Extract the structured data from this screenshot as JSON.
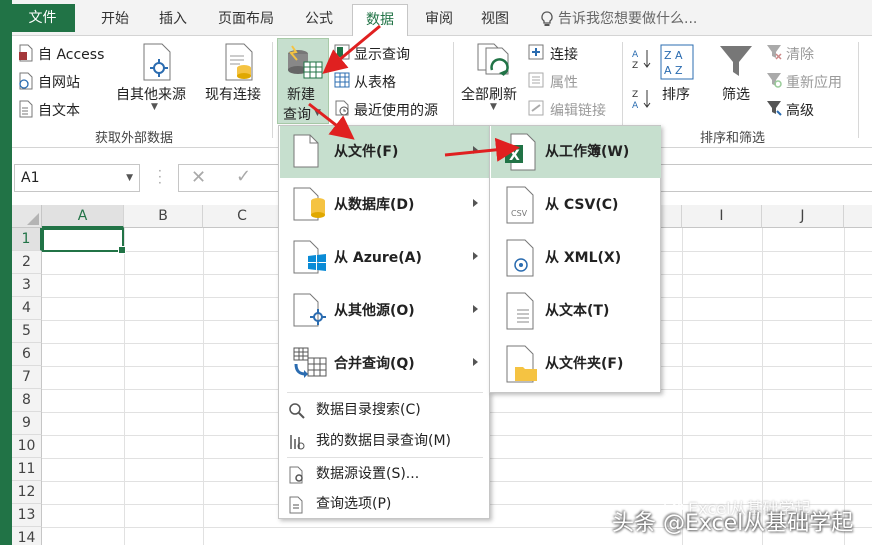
{
  "tabs": {
    "file": "文件",
    "home": "开始",
    "insert": "插入",
    "layout": "页面布局",
    "formulas": "公式",
    "data": "数据",
    "review": "审阅",
    "view": "视图",
    "tell_me": "告诉我您想要做什么..."
  },
  "ribbon": {
    "get_external": {
      "from_access": "自 Access",
      "from_web": "自网站",
      "from_text": "自文本",
      "from_other_l1": "自其他来源",
      "existing_conn": "现有连接",
      "group_label": "获取外部数据"
    },
    "get_transform": {
      "new_query_l1": "新建",
      "new_query_l2": "查询",
      "show_queries": "显示查询",
      "from_table": "从表格",
      "recent_sources": "最近使用的源"
    },
    "connections": {
      "refresh_all": "全部刷新",
      "connections": "连接",
      "properties": "属性",
      "edit_links": "编辑链接"
    },
    "sort_filter": {
      "sort": "排序",
      "filter": "筛选",
      "clear": "清除",
      "reapply": "重新应用",
      "advanced": "高级",
      "group_label": "排序和筛选"
    }
  },
  "formula_bar": {
    "name_box": "A1"
  },
  "grid": {
    "columns": [
      "A",
      "B",
      "C",
      "I",
      "J"
    ],
    "rows": [
      "1",
      "2",
      "3",
      "4",
      "5",
      "6",
      "7",
      "8",
      "9",
      "10",
      "11",
      "12",
      "13",
      "14"
    ]
  },
  "new_query_menu": {
    "items": [
      {
        "label": "从文件(F)"
      },
      {
        "label": "从数据库(D)"
      },
      {
        "label": "从 Azure(A)"
      },
      {
        "label": "从其他源(O)"
      },
      {
        "label": "合并查询(Q)"
      }
    ],
    "secondary": [
      {
        "label": "数据目录搜索(C)"
      },
      {
        "label": "我的数据目录查询(M)"
      },
      {
        "label": "数据源设置(S)..."
      },
      {
        "label": "查询选项(P)"
      }
    ]
  },
  "from_file_menu": {
    "items": [
      {
        "label": "从工作簿(W)"
      },
      {
        "label": "从 CSV(C)"
      },
      {
        "label": "从 XML(X)"
      },
      {
        "label": "从文本(T)"
      },
      {
        "label": "从文件夹(F)"
      }
    ]
  },
  "watermark": {
    "line1": "Excel从基础学起",
    "line2": "头条 @Excel从基础学起"
  },
  "colors": {
    "excel_green": "#217346",
    "highlight": "#c6dfce",
    "annotation_red": "#e02020"
  }
}
